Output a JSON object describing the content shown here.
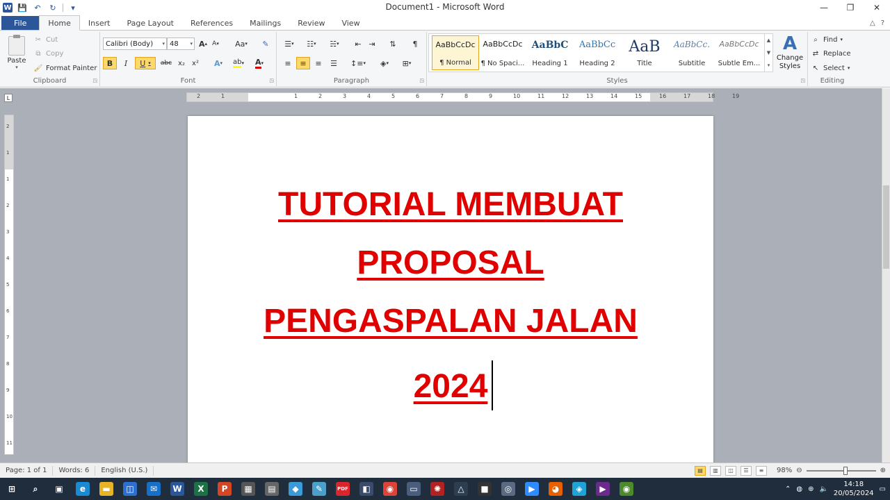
{
  "window": {
    "title": "Document1  -  Microsoft Word",
    "controls": [
      "—",
      "❐",
      "✕"
    ]
  },
  "qat": {
    "save": "💾",
    "undo": "↶",
    "redo": "↻",
    "customize": "▾"
  },
  "tabs": [
    "File",
    "Home",
    "Insert",
    "Page Layout",
    "References",
    "Mailings",
    "Review",
    "View"
  ],
  "ribbon_right": [
    "△",
    "?"
  ],
  "clipboard": {
    "paste": "Paste",
    "cut": "Cut",
    "copy": "Copy",
    "format_painter": "Format Painter",
    "label": "Clipboard"
  },
  "font": {
    "name": "Calibri (Body)",
    "size": "48",
    "grow": "A",
    "shrink": "A",
    "change_case": "Aa",
    "bold": "B",
    "italic": "I",
    "underline": "U",
    "strike": "abc",
    "subscript": "x₂",
    "superscript": "x²",
    "highlight": "ab",
    "font_color": "A",
    "label": "Font"
  },
  "paragraph": {
    "pilcrow": "¶",
    "label": "Paragraph"
  },
  "styles": {
    "items": [
      {
        "sample": "AaBbCcDc",
        "name": "¶ Normal"
      },
      {
        "sample": "AaBbCcDc",
        "name": "¶ No Spaci..."
      },
      {
        "sample": "AaBbC",
        "name": "Heading 1"
      },
      {
        "sample": "AaBbCc",
        "name": "Heading 2"
      },
      {
        "sample": "AaB",
        "name": "Title"
      },
      {
        "sample": "AaBbCc.",
        "name": "Subtitle"
      },
      {
        "sample": "AaBbCcDc",
        "name": "Subtle Em..."
      }
    ],
    "change_styles": "Change Styles",
    "label": "Styles"
  },
  "editing": {
    "find": "Find",
    "replace": "Replace",
    "select": "Select",
    "label": "Editing"
  },
  "ruler": {
    "h_numbers": [
      "2",
      "1",
      "1",
      "2",
      "3",
      "4",
      "5",
      "6",
      "7",
      "8",
      "9",
      "10",
      "11",
      "12",
      "13",
      "14",
      "15",
      "16",
      "17",
      "18",
      "19"
    ],
    "v_numbers": [
      "2",
      "1",
      "1",
      "2",
      "3",
      "4",
      "5",
      "6",
      "7",
      "8",
      "9",
      "10",
      "11"
    ]
  },
  "document": {
    "lines": [
      "TUTORIAL MEMBUAT",
      "PROPOSAL",
      "PENGASPALAN JALAN",
      "2024"
    ],
    "color": "#e00000"
  },
  "status": {
    "page": "Page: 1 of 1",
    "words": "Words: 6",
    "language": "English (U.S.)",
    "zoom": "98%",
    "zoom_level_percent": 98
  },
  "taskbar": {
    "icons": [
      {
        "name": "start",
        "glyph": "⊞",
        "color": "#1f2d3d"
      },
      {
        "name": "search",
        "glyph": "⌕",
        "color": "#1f2d3d"
      },
      {
        "name": "task-view",
        "glyph": "▣",
        "color": "#1f2d3d"
      },
      {
        "name": "edge",
        "glyph": "e",
        "color": "#1a8ad4"
      },
      {
        "name": "file-explorer",
        "glyph": "▬",
        "color": "#e8b324"
      },
      {
        "name": "store",
        "glyph": "◫",
        "color": "#2c6fcf"
      },
      {
        "name": "mail",
        "glyph": "✉",
        "color": "#1470c8"
      },
      {
        "name": "word",
        "glyph": "W",
        "color": "#2b579a"
      },
      {
        "name": "excel",
        "glyph": "X",
        "color": "#1e7145"
      },
      {
        "name": "powerpoint",
        "glyph": "P",
        "color": "#d24726"
      },
      {
        "name": "calculator",
        "glyph": "▦",
        "color": "#555555"
      },
      {
        "name": "calculator-2",
        "glyph": "▤",
        "color": "#666666"
      },
      {
        "name": "app-blue",
        "glyph": "◆",
        "color": "#3a9bd8"
      },
      {
        "name": "paint",
        "glyph": "✎",
        "color": "#4aa0c8"
      },
      {
        "name": "pdf",
        "glyph": "PDF",
        "color": "#d8262c"
      },
      {
        "name": "photo-app",
        "glyph": "◧",
        "color": "#3b4b6b"
      },
      {
        "name": "chrome",
        "glyph": "◉",
        "color": "#db4437"
      },
      {
        "name": "screen-app",
        "glyph": "▭",
        "color": "#4b5d7c"
      },
      {
        "name": "app-red",
        "glyph": "✺",
        "color": "#b22222"
      },
      {
        "name": "inkscape",
        "glyph": "△",
        "color": "#2d3e50"
      },
      {
        "name": "app-dark",
        "glyph": "■",
        "color": "#333333"
      },
      {
        "name": "camera",
        "glyph": "◎",
        "color": "#5a6a80"
      },
      {
        "name": "zoom",
        "glyph": "▶",
        "color": "#2d8cff"
      },
      {
        "name": "firefox",
        "glyph": "◕",
        "color": "#e66000"
      },
      {
        "name": "app-cyan",
        "glyph": "◈",
        "color": "#1fa3d6"
      },
      {
        "name": "media-player",
        "glyph": "▶",
        "color": "#6b2a8c"
      },
      {
        "name": "app-owl",
        "glyph": "◉",
        "color": "#4c8a2b"
      }
    ],
    "time": "14:18",
    "date": "20/05/2024"
  }
}
